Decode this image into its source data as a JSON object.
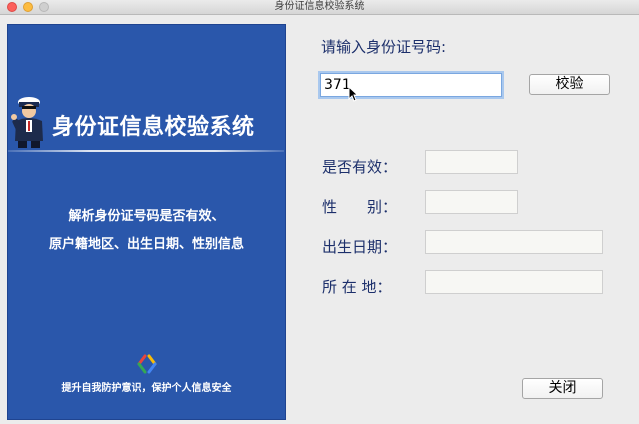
{
  "window": {
    "title": "身份证信息校验系统",
    "controls": [
      "close-button",
      "minimize-button",
      "zoom-button"
    ]
  },
  "banner": {
    "heading": "身份证信息校验系统",
    "description_line1": "解析身份证号码是否有效、",
    "description_line2": "原户籍地区、出生日期、性别信息",
    "slogan": "提升自我防护意识，保护个人信息安全",
    "colors": {
      "background": "#2a57ab",
      "text": "#ffffff"
    },
    "icons": [
      "police-officer-icon",
      "colorful-brackets-logo-icon"
    ]
  },
  "form": {
    "prompt_label": "请输入身份证号码:",
    "id_input": {
      "value": "371",
      "placeholder": ""
    },
    "check_button_label": "校验",
    "fields": {
      "valid_label": "是否有效：",
      "valid_value": "",
      "gender_label": "性　　别：",
      "gender_value": "",
      "birthdate_label": "出生日期：",
      "birthdate_value": "",
      "location_label": "所 在 地：",
      "location_value": ""
    },
    "close_button_label": "关闭",
    "colors": {
      "label_text": "#1c2f6b"
    }
  }
}
